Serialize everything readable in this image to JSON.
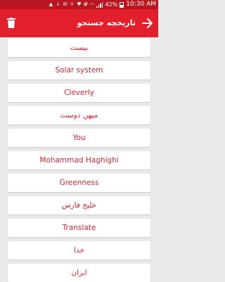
{
  "status_bar": {
    "battery": "42%",
    "time": "10:30 AM"
  },
  "toolbar": {
    "title": "تاریخچه جستجو",
    "back_icon": "arrow-right-icon",
    "delete_icon": "trash-icon"
  },
  "history": [
    "بیست",
    "Solar system",
    "Cleverly",
    "میهن دوست",
    "You",
    "Mohammad Haghighi",
    "Greenness",
    "خلیج فارس",
    "Translate",
    "خدا",
    "ایران"
  ],
  "colors": {
    "accent": "#e11f2d",
    "status_bar": "#b81722",
    "item_text": "#d6232f",
    "background": "#e9e9e9"
  }
}
